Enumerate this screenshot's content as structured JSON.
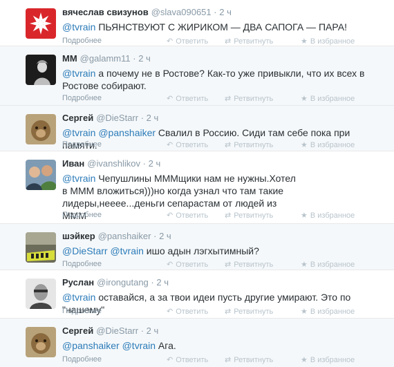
{
  "labels": {
    "more": "Подробнее",
    "reply": "Ответить",
    "retweet": "Ретвитнуть",
    "favorite": "В избранное",
    "reply_icon": "reply-icon",
    "retweet_icon": "retweet-icon",
    "favorite_icon": "star-icon"
  },
  "colors": {
    "mention": "#2b7bb9",
    "meta": "#8899a6",
    "name": "#292f33"
  },
  "tweets": [
    {
      "name": "вячеслав свизунов",
      "handle": "@slava090651",
      "dot": "·",
      "time": "2 ч",
      "m1": "@tvrain",
      "t1": " ПЬЯНСТВУЮТ С ЖИРИКОМ — ДВА САПОГА — ПАРА!"
    },
    {
      "name": "ММ",
      "handle": "@galamm11",
      "dot": "·",
      "time": "2 ч",
      "m1": "@tvrain",
      "t1": " а почему не в Ростове? Как-то  уже привыкли, что их всех в Ростове собирают."
    },
    {
      "name": "Сергей",
      "handle": "@DieStarr",
      "dot": "·",
      "time": "2 ч",
      "m1": "@tvrain",
      "m2": "@panshaiker",
      "t2": " Свалил в Россию. Сиди там себе пока при памяти."
    },
    {
      "name": "Иван",
      "handle": "@ivanshlikov",
      "dot": "·",
      "time": "2 ч",
      "m1": "@tvrain",
      "t1": " Чепушлины МММщики нам не нужны.Хотел в МММ вложиться)))но когда узнал что там такие лидеры,нееее...деньги сепарастам от людей из МММ"
    },
    {
      "name": "шэйкер",
      "handle": "@panshaiker",
      "dot": "·",
      "time": "2 ч",
      "m1": "@DieStarr",
      "m2": "@tvrain",
      "t2": " ишо адын лэгхытимный?"
    },
    {
      "name": "Руслан",
      "handle": "@irongutang",
      "dot": "·",
      "time": "2 ч",
      "m1": "@tvrain",
      "t1": " оставайся, а за твои идеи пусть другие умирают. Это по \"нашему\""
    },
    {
      "name": "Сергей",
      "handle": "@DieStarr",
      "dot": "·",
      "time": "2 ч",
      "m1": "@panshaiker",
      "m2": "@tvrain",
      "t2": " Ага."
    }
  ]
}
